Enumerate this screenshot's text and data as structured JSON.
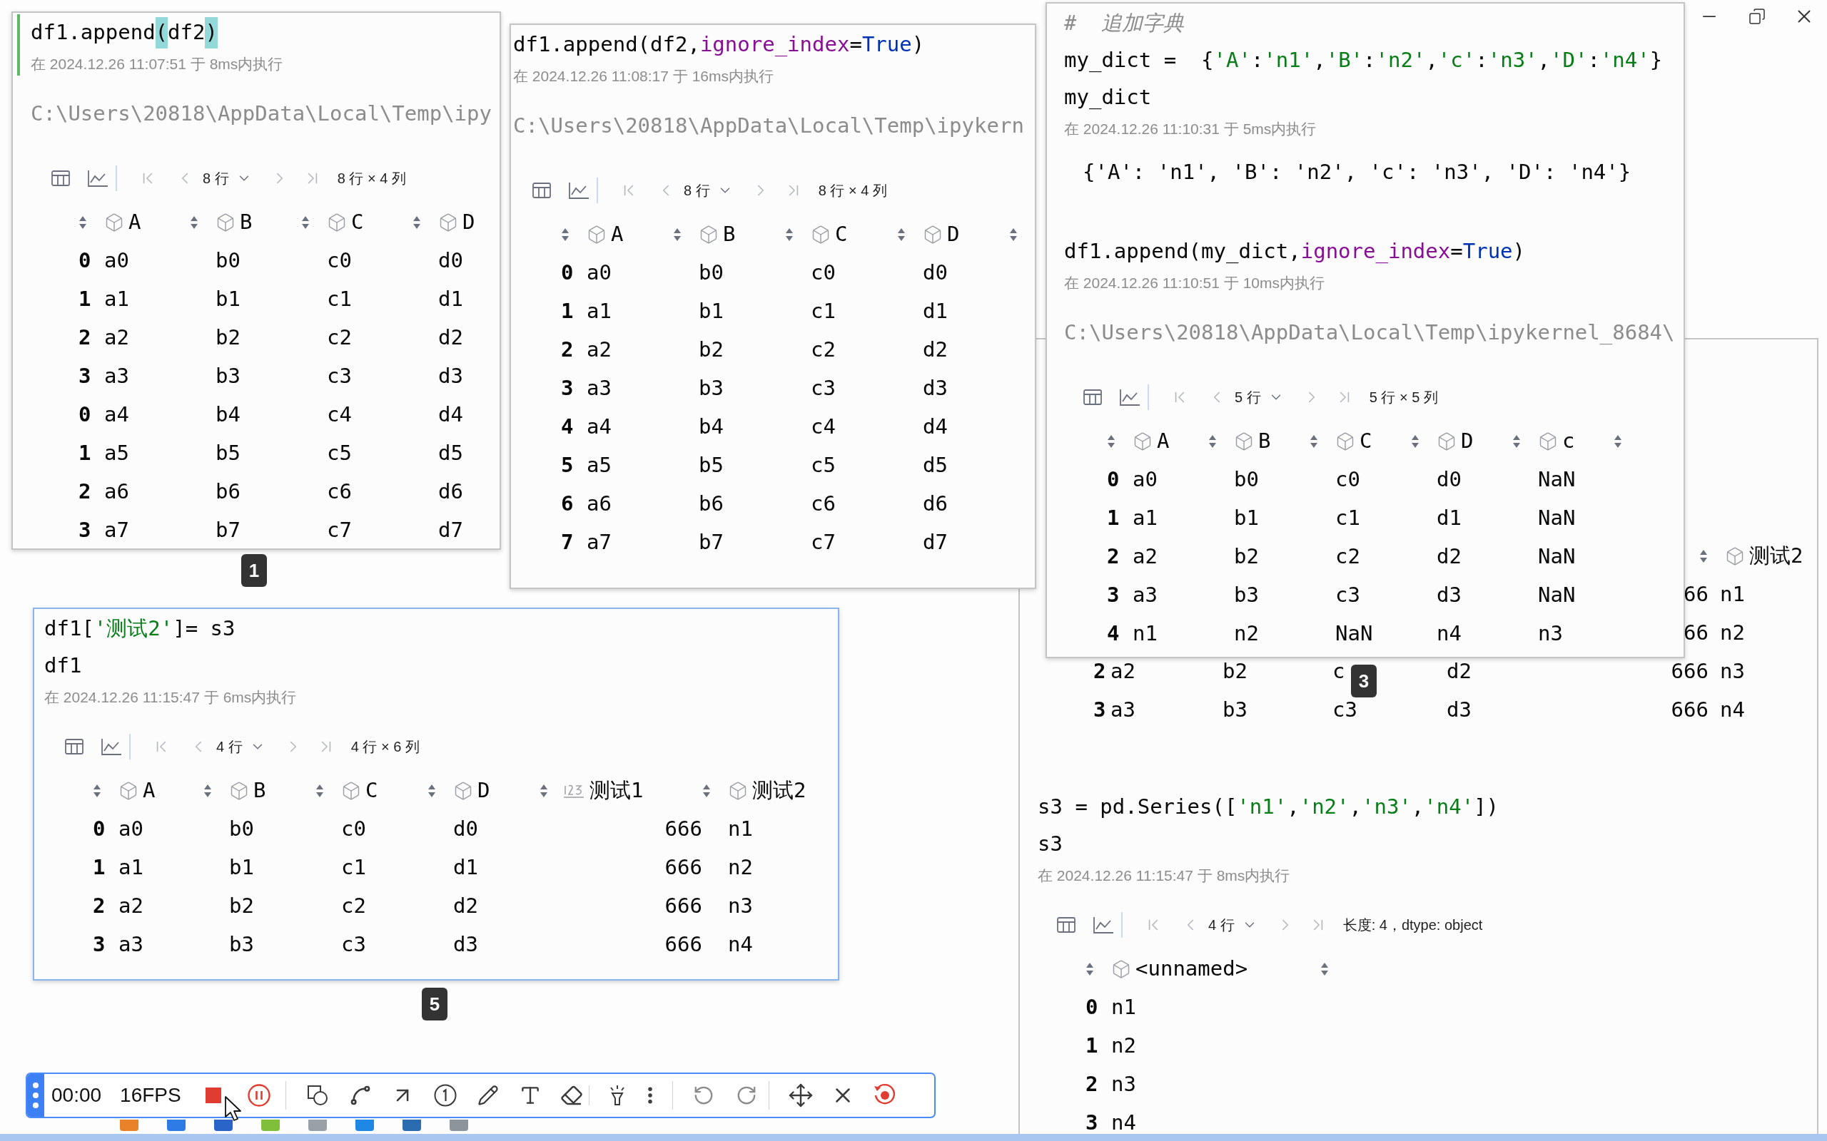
{
  "snapshots": [
    {
      "badge": "1",
      "cells": [
        {
          "selected": true,
          "code": [
            [
              {
                "text": "df1.append",
                "kind": "plain"
              },
              {
                "text": "(",
                "kind": "match"
              },
              {
                "text": "df2",
                "kind": "plain"
              },
              {
                "text": ")",
                "kind": "match"
              }
            ]
          ],
          "timestamp": "在 2024.12.26 11:07:51 于 8ms内执行",
          "stderr": "C:\\Users\\20818\\AppData\\Local\\Temp\\ipy",
          "table": {
            "rows_label": "8 行",
            "shape": "8 行 × 4 列",
            "columns": [
              {
                "label": "A",
                "kind": "object"
              },
              {
                "label": "B",
                "kind": "object"
              },
              {
                "label": "C",
                "kind": "object"
              },
              {
                "label": "D",
                "kind": "object"
              }
            ],
            "rows": [
              {
                "index": "0",
                "values": [
                  "a0",
                  "b0",
                  "c0",
                  "d0"
                ]
              },
              {
                "index": "1",
                "values": [
                  "a1",
                  "b1",
                  "c1",
                  "d1"
                ]
              },
              {
                "index": "2",
                "values": [
                  "a2",
                  "b2",
                  "c2",
                  "d2"
                ]
              },
              {
                "index": "3",
                "values": [
                  "a3",
                  "b3",
                  "c3",
                  "d3"
                ]
              },
              {
                "index": "0",
                "values": [
                  "a4",
                  "b4",
                  "c4",
                  "d4"
                ]
              },
              {
                "index": "1",
                "values": [
                  "a5",
                  "b5",
                  "c5",
                  "d5"
                ]
              },
              {
                "index": "2",
                "values": [
                  "a6",
                  "b6",
                  "c6",
                  "d6"
                ]
              },
              {
                "index": "3",
                "values": [
                  "a7",
                  "b7",
                  "c7",
                  "d7"
                ]
              }
            ]
          }
        }
      ]
    },
    {
      "cells": [
        {
          "code": [
            [
              {
                "text": "df1.append(df2,",
                "kind": "plain"
              },
              {
                "text": "ignore_index",
                "kind": "kwarg"
              },
              {
                "text": "=",
                "kind": "plain"
              },
              {
                "text": "True",
                "kind": "bool"
              },
              {
                "text": ")",
                "kind": "plain"
              }
            ]
          ],
          "timestamp": "在 2024.12.26 11:08:17 于 16ms内执行",
          "stderr": "C:\\Users\\20818\\AppData\\Local\\Temp\\ipykern",
          "table": {
            "rows_label": "8 行",
            "shape": "8 行 × 4 列",
            "columns": [
              {
                "label": "A",
                "kind": "object"
              },
              {
                "label": "B",
                "kind": "object"
              },
              {
                "label": "C",
                "kind": "object"
              },
              {
                "label": "D",
                "kind": "object"
              }
            ],
            "rows": [
              {
                "index": "0",
                "values": [
                  "a0",
                  "b0",
                  "c0",
                  "d0"
                ]
              },
              {
                "index": "1",
                "values": [
                  "a1",
                  "b1",
                  "c1",
                  "d1"
                ]
              },
              {
                "index": "2",
                "values": [
                  "a2",
                  "b2",
                  "c2",
                  "d2"
                ]
              },
              {
                "index": "3",
                "values": [
                  "a3",
                  "b3",
                  "c3",
                  "d3"
                ]
              },
              {
                "index": "4",
                "values": [
                  "a4",
                  "b4",
                  "c4",
                  "d4"
                ]
              },
              {
                "index": "5",
                "values": [
                  "a5",
                  "b5",
                  "c5",
                  "d5"
                ]
              },
              {
                "index": "6",
                "values": [
                  "a6",
                  "b6",
                  "c6",
                  "d6"
                ]
              },
              {
                "index": "7",
                "values": [
                  "a7",
                  "b7",
                  "c7",
                  "d7"
                ]
              }
            ]
          }
        }
      ]
    },
    {
      "badge": "3",
      "cells": [
        {
          "code": [
            [
              {
                "text": "#  追加字典",
                "kind": "comment"
              }
            ],
            [
              {
                "text": "my_dict =  {",
                "kind": "plain"
              },
              {
                "text": "'A'",
                "kind": "string"
              },
              {
                "text": ":",
                "kind": "plain"
              },
              {
                "text": "'n1'",
                "kind": "string"
              },
              {
                "text": ",",
                "kind": "plain"
              },
              {
                "text": "'B'",
                "kind": "string"
              },
              {
                "text": ":",
                "kind": "plain"
              },
              {
                "text": "'n2'",
                "kind": "string"
              },
              {
                "text": ",",
                "kind": "plain"
              },
              {
                "text": "'c'",
                "kind": "string"
              },
              {
                "text": ":",
                "kind": "plain"
              },
              {
                "text": "'n3'",
                "kind": "string"
              },
              {
                "text": ",",
                "kind": "plain"
              },
              {
                "text": "'D'",
                "kind": "string"
              },
              {
                "text": ":",
                "kind": "plain"
              },
              {
                "text": "'n4'",
                "kind": "string"
              },
              {
                "text": "}",
                "kind": "plain"
              }
            ],
            [
              {
                "text": "my_dict",
                "kind": "plain"
              }
            ]
          ],
          "timestamp": "在 2024.12.26 11:10:31 于 5ms内执行",
          "output": "{'A': 'n1', 'B': 'n2', 'c': 'n3', 'D': 'n4'}"
        },
        {
          "code": [
            [
              {
                "text": "df1.append(my_dict,",
                "kind": "plain"
              },
              {
                "text": "ignore_index",
                "kind": "kwarg"
              },
              {
                "text": "=",
                "kind": "plain"
              },
              {
                "text": "True",
                "kind": "bool"
              },
              {
                "text": ")",
                "kind": "plain"
              }
            ]
          ],
          "timestamp": "在 2024.12.26 11:10:51 于 10ms内执行",
          "stderr": "C:\\Users\\20818\\AppData\\Local\\Temp\\ipykernel_8684\\",
          "table": {
            "rows_label": "5 行",
            "shape": "5 行 × 5 列",
            "columns": [
              {
                "label": "A",
                "kind": "object"
              },
              {
                "label": "B",
                "kind": "object"
              },
              {
                "label": "C",
                "kind": "object"
              },
              {
                "label": "D",
                "kind": "object"
              },
              {
                "label": "c",
                "kind": "object"
              }
            ],
            "rows": [
              {
                "index": "0",
                "values": [
                  "a0",
                  "b0",
                  "c0",
                  "d0",
                  "NaN"
                ]
              },
              {
                "index": "1",
                "values": [
                  "a1",
                  "b1",
                  "c1",
                  "d1",
                  "NaN"
                ]
              },
              {
                "index": "2",
                "values": [
                  "a2",
                  "b2",
                  "c2",
                  "d2",
                  "NaN"
                ]
              },
              {
                "index": "3",
                "values": [
                  "a3",
                  "b3",
                  "c3",
                  "d3",
                  "NaN"
                ]
              },
              {
                "index": "4",
                "values": [
                  "n1",
                  "n2",
                  "NaN",
                  "n4",
                  "n3"
                ]
              }
            ]
          }
        }
      ]
    },
    {
      "badge": "5",
      "cells": [
        {
          "code": [
            [
              {
                "text": "df1[",
                "kind": "plain"
              },
              {
                "text": "'测试2'",
                "kind": "string"
              },
              {
                "text": "]= s3",
                "kind": "plain"
              }
            ],
            [
              {
                "text": "df1",
                "kind": "plain"
              }
            ]
          ],
          "timestamp": "在 2024.12.26 11:15:47 于 6ms内执行",
          "table": {
            "rows_label": "4 行",
            "shape": "4 行 × 6 列",
            "columns": [
              {
                "label": "A",
                "kind": "object"
              },
              {
                "label": "B",
                "kind": "object"
              },
              {
                "label": "C",
                "kind": "object"
              },
              {
                "label": "D",
                "kind": "object"
              },
              {
                "label": "测试1",
                "kind": "numeric"
              },
              {
                "label": "测试2",
                "kind": "object"
              }
            ],
            "rows": [
              {
                "index": "0",
                "values": [
                  "a0",
                  "b0",
                  "c0",
                  "d0",
                  "666",
                  "n1"
                ]
              },
              {
                "index": "1",
                "values": [
                  "a1",
                  "b1",
                  "c1",
                  "d1",
                  "666",
                  "n2"
                ]
              },
              {
                "index": "2",
                "values": [
                  "a2",
                  "b2",
                  "c2",
                  "d2",
                  "666",
                  "n3"
                ]
              },
              {
                "index": "3",
                "values": [
                  "a3",
                  "b3",
                  "c3",
                  "d3",
                  "666",
                  "n4"
                ]
              }
            ]
          }
        }
      ]
    }
  ],
  "notebook": {
    "table_fragment": {
      "columns": [
        {
          "label": "测试2",
          "kind": "object"
        }
      ],
      "partial_rows": [
        {
          "values": [
            "66",
            "n1"
          ]
        },
        {
          "values": [
            "66",
            "n2"
          ]
        }
      ],
      "rows": [
        {
          "index": "2",
          "values": [
            "a2",
            "b2",
            "c",
            "d2",
            "666",
            "n3"
          ]
        },
        {
          "index": "3",
          "values": [
            "a3",
            "b3",
            "c3",
            "d3",
            "666",
            "n4"
          ]
        }
      ]
    },
    "cells": [
      {
        "code": [
          [
            {
              "text": "s3 = pd.Series([",
              "kind": "plain"
            },
            {
              "text": "'n1'",
              "kind": "string"
            },
            {
              "text": ",",
              "kind": "plain"
            },
            {
              "text": "'n2'",
              "kind": "string"
            },
            {
              "text": ",",
              "kind": "plain"
            },
            {
              "text": "'n3'",
              "kind": "string"
            },
            {
              "text": ",",
              "kind": "plain"
            },
            {
              "text": "'n4'",
              "kind": "string"
            },
            {
              "text": "])",
              "kind": "plain"
            }
          ],
          [
            {
              "text": "s3",
              "kind": "plain"
            }
          ]
        ],
        "timestamp": "在 2024.12.26 11:15:47 于 8ms内执行",
        "table": {
          "rows_label": "4 行",
          "shape": "长度: 4，dtype: object",
          "columns": [
            {
              "label": "<unnamed>",
              "kind": "object"
            }
          ],
          "rows": [
            {
              "index": "0",
              "values": [
                "n1"
              ]
            },
            {
              "index": "1",
              "values": [
                "n2"
              ]
            },
            {
              "index": "2",
              "values": [
                "n3"
              ]
            },
            {
              "index": "3",
              "values": [
                "n4"
              ]
            }
          ]
        }
      }
    ]
  },
  "recorder": {
    "timer": "00:00",
    "fps": "16FPS"
  }
}
